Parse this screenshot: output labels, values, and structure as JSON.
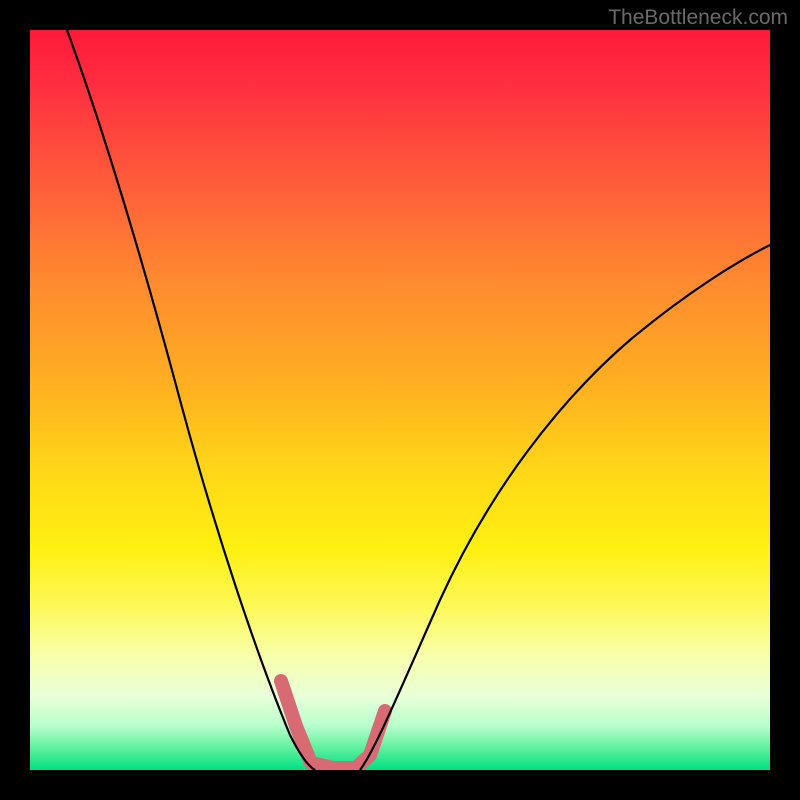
{
  "watermark": "TheBottleneck.com",
  "chart_data": {
    "type": "line",
    "title": "",
    "xlabel": "",
    "ylabel": "",
    "xlim": [
      0,
      100
    ],
    "ylim": [
      0,
      100
    ],
    "gradient_stops": [
      {
        "pct": 0,
        "color": "#ff1a3a"
      },
      {
        "pct": 8,
        "color": "#ff3040"
      },
      {
        "pct": 20,
        "color": "#ff5a3a"
      },
      {
        "pct": 34,
        "color": "#ff8a30"
      },
      {
        "pct": 48,
        "color": "#ffb020"
      },
      {
        "pct": 60,
        "color": "#ffd818"
      },
      {
        "pct": 70,
        "color": "#fff010"
      },
      {
        "pct": 78,
        "color": "#fdf95a"
      },
      {
        "pct": 85,
        "color": "#f8ffb0"
      },
      {
        "pct": 90,
        "color": "#e8ffd8"
      },
      {
        "pct": 94,
        "color": "#b8ffcc"
      },
      {
        "pct": 97,
        "color": "#60f0a0"
      },
      {
        "pct": 100,
        "color": "#00e080"
      }
    ],
    "series": [
      {
        "name": "left-curve",
        "x": [
          5,
          8,
          12,
          16,
          20,
          24,
          28,
          31,
          34,
          36,
          37,
          38
        ],
        "y": [
          100,
          90,
          77,
          63,
          50,
          37,
          25,
          15,
          8,
          4,
          2,
          0
        ]
      },
      {
        "name": "right-curve",
        "x": [
          45,
          46,
          48,
          51,
          55,
          60,
          66,
          73,
          80,
          88,
          96,
          100
        ],
        "y": [
          0,
          2,
          6,
          12,
          20,
          29,
          38,
          47,
          55,
          62,
          68,
          71
        ]
      }
    ],
    "highlight_segment": {
      "name": "valley-marker",
      "color": "#d86a74",
      "stroke_width": 12,
      "points": [
        {
          "x": 34,
          "y": 12
        },
        {
          "x": 36,
          "y": 6
        },
        {
          "x": 38,
          "y": 1
        },
        {
          "x": 41,
          "y": 0
        },
        {
          "x": 44,
          "y": 0
        },
        {
          "x": 46,
          "y": 2
        },
        {
          "x": 48,
          "y": 8
        }
      ]
    }
  }
}
